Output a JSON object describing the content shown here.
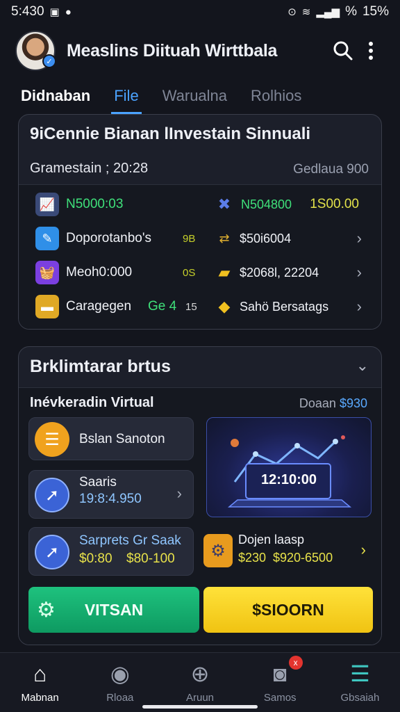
{
  "status_bar": {
    "time": "5:430",
    "battery": "15%",
    "signal_text": "%"
  },
  "header": {
    "title": "Measlins Diituah Wirttbala",
    "avatar_badge": "✓",
    "search_icon": "search-icon",
    "menu_icon": "more-vertical-icon"
  },
  "tabs": [
    {
      "label": "Didnaban"
    },
    {
      "label": "File"
    },
    {
      "label": "Warualna"
    },
    {
      "label": "Rolhios"
    }
  ],
  "summary_card": {
    "title": "9iCennie Bianan lInvestain Sinnuali",
    "subtitle": "Gramestain ; 20:28",
    "subtitle_right": "Gedlaua 900",
    "rows": [
      {
        "label": "N5000:03",
        "value": "N504800",
        "amount": "1S00.00",
        "icon": "chart-icon",
        "icon2": "x-icon"
      },
      {
        "label": "Doporotanbo's",
        "tag": "9B",
        "value": "$50i6004",
        "icon": "edit-icon",
        "icon2": "arrows-icon"
      },
      {
        "label": "Meoh0:000",
        "tag": "0S",
        "value": "$2068l, 22204",
        "icon": "basket-icon",
        "icon2": "gold-bar-icon"
      },
      {
        "label": "Caragegen",
        "label_accent": "Ge 4",
        "tag": "15",
        "value": "Sahö Bersatags",
        "icon": "folder-icon",
        "icon2": "coin-stack-icon"
      }
    ]
  },
  "simulator_card": {
    "title": "Brklimtarar brtus",
    "subtitle": "Inévkeradin Virtual",
    "subtitle_right_label": "Doaan",
    "subtitle_right_value": "$930",
    "tiles": [
      {
        "label": "Bslan Sanoton",
        "icon": "document-icon"
      },
      {
        "label": "Saaris",
        "value": "19:8:4.950",
        "icon": "compass-icon"
      },
      {
        "label": "Sarprets Gr Saak",
        "value_a": "$0:80",
        "value_b": "$80-100",
        "icon": "compass-icon"
      }
    ],
    "laptop_value": "12:10:00",
    "side_item": {
      "label": "Dojen laasp",
      "value_a": "$230",
      "value_b": "$920-6500",
      "icon": "gear-doc-icon"
    },
    "buttons": {
      "primary": "VITSAN",
      "secondary": "$SIOORN"
    }
  },
  "bottom_nav": [
    {
      "label": "Mabnan",
      "icon": "home-icon"
    },
    {
      "label": "Rloaa",
      "icon": "user-icon"
    },
    {
      "label": "Aruun",
      "icon": "plus-circle-icon"
    },
    {
      "label": "Samos",
      "icon": "camera-icon",
      "badge": "x"
    },
    {
      "label": "Gbsaiah",
      "icon": "menu-icon"
    }
  ],
  "colors": {
    "background": "#13151d",
    "accent_blue": "#4ba3ff",
    "green_button": "#1ec27e",
    "yellow_button": "#ffe23a",
    "row_green_text": "#3fe07a"
  }
}
